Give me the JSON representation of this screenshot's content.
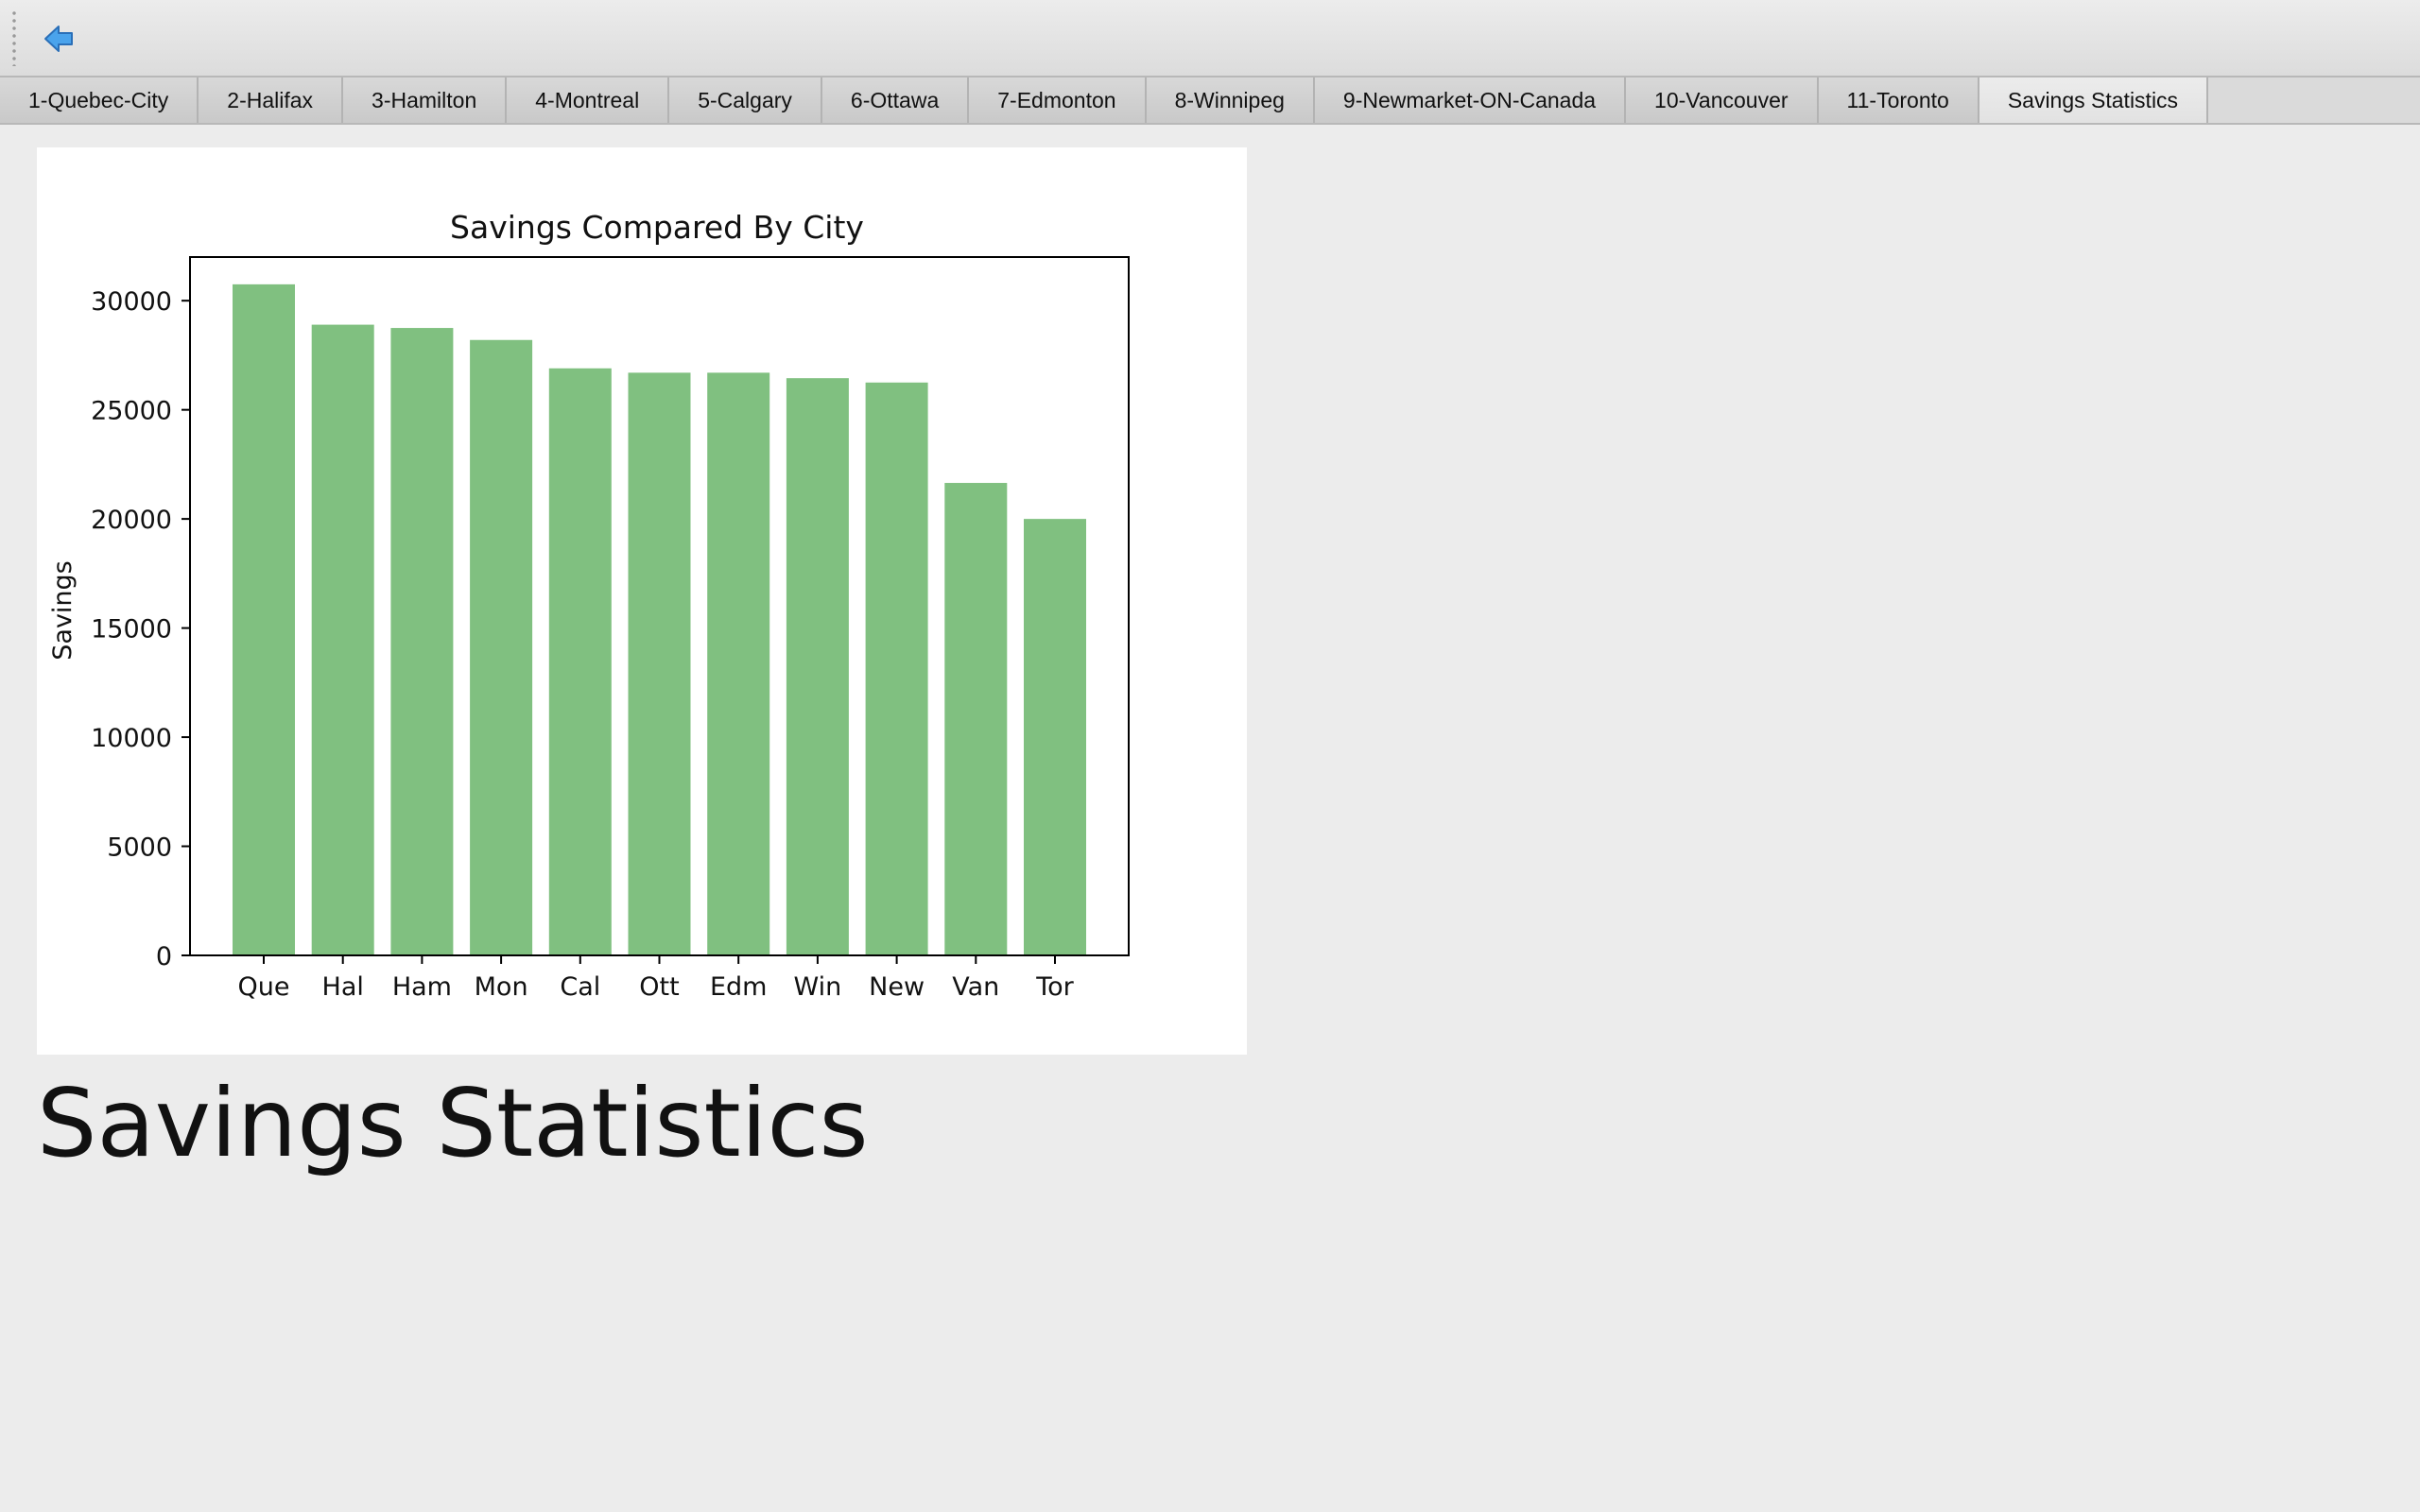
{
  "tabs": [
    {
      "label": "1-Quebec-City",
      "active": false
    },
    {
      "label": "2-Halifax",
      "active": false
    },
    {
      "label": "3-Hamilton",
      "active": false
    },
    {
      "label": "4-Montreal",
      "active": false
    },
    {
      "label": "5-Calgary",
      "active": false
    },
    {
      "label": "6-Ottawa",
      "active": false
    },
    {
      "label": "7-Edmonton",
      "active": false
    },
    {
      "label": "8-Winnipeg",
      "active": false
    },
    {
      "label": "9-Newmarket-ON-Canada",
      "active": false
    },
    {
      "label": "10-Vancouver",
      "active": false
    },
    {
      "label": "11-Toronto",
      "active": false
    },
    {
      "label": "Savings Statistics",
      "active": true
    }
  ],
  "toolbar": {
    "back_icon": "back-arrow-icon",
    "accent": "#3b8fe0"
  },
  "page": {
    "heading": "Savings Statistics"
  },
  "chart_data": {
    "type": "bar",
    "title": "Savings Compared By City",
    "xlabel": "",
    "ylabel": "Savings",
    "categories": [
      "Que",
      "Hal",
      "Ham",
      "Mon",
      "Cal",
      "Ott",
      "Edm",
      "Win",
      "New",
      "Van",
      "Tor"
    ],
    "values": [
      30750,
      28900,
      28750,
      28200,
      26900,
      26700,
      26700,
      26450,
      26250,
      21650,
      20000
    ],
    "ylim": [
      0,
      32000
    ],
    "yticks": [
      0,
      5000,
      10000,
      15000,
      20000,
      25000,
      30000
    ],
    "bar_color": "#80c080",
    "grid": false,
    "legend": "none"
  }
}
